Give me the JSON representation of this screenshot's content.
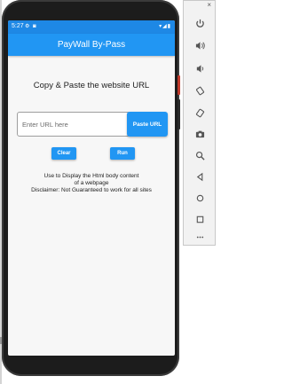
{
  "status": {
    "time": "5:27",
    "left_icons": "⚙ ◙",
    "right_icons": "▾◢▮"
  },
  "app": {
    "title": "PayWall By-Pass"
  },
  "main": {
    "heading": "Copy & Paste the website URL",
    "url_field": {
      "placeholder": "Enter URL here",
      "value": ""
    },
    "paste_button": "Paste URL",
    "clear_button": "Clear",
    "run_button": "Run",
    "info_lines": [
      "Use to Display the Html body content",
      "of a webpage",
      "Disclaimer: Not Guaranteed to work for all sites"
    ]
  },
  "toolbar": {
    "close_label": "×",
    "icons": [
      "power-icon",
      "volume-up-icon",
      "volume-down-icon",
      "rotate-left-icon",
      "rotate-right-icon",
      "camera-icon",
      "zoom-icon",
      "back-icon",
      "home-icon",
      "overview-icon",
      "more-icon"
    ]
  },
  "colors": {
    "primary": "#2196f3",
    "status_bar": "#1e88e5"
  }
}
